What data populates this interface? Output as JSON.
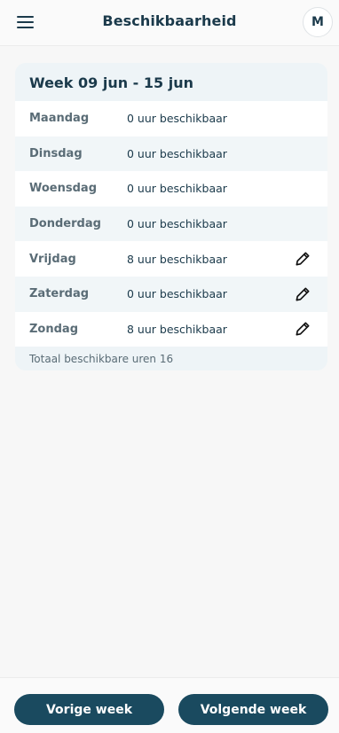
{
  "header": {
    "title": "Beschikbaarheid",
    "menu_icon": "hamburger-menu-icon",
    "avatar_initial": "M"
  },
  "week": {
    "label": "Week 09 jun - 15 jun",
    "days": [
      {
        "day": "Maandag",
        "hours": "0 uur beschikbaar",
        "editable": false
      },
      {
        "day": "Dinsdag",
        "hours": "0 uur beschikbaar",
        "editable": false
      },
      {
        "day": "Woensdag",
        "hours": "0 uur beschikbaar",
        "editable": false
      },
      {
        "day": "Donderdag",
        "hours": "0 uur beschikbaar",
        "editable": false
      },
      {
        "day": "Vrijdag",
        "hours": "8 uur beschikbaar",
        "editable": true
      },
      {
        "day": "Zaterdag",
        "hours": "0 uur beschikbaar",
        "editable": true
      },
      {
        "day": "Zondag",
        "hours": "8 uur beschikbaar",
        "editable": true
      }
    ],
    "total": "Totaal beschikbare uren 16"
  },
  "footer": {
    "prev_label": "Vorige week",
    "next_label": "Volgende week"
  },
  "colors": {
    "primary": "#1a4a5f",
    "text": "#1b3a4b",
    "muted": "#5a6c76",
    "card_bg": "#eef4f7"
  }
}
